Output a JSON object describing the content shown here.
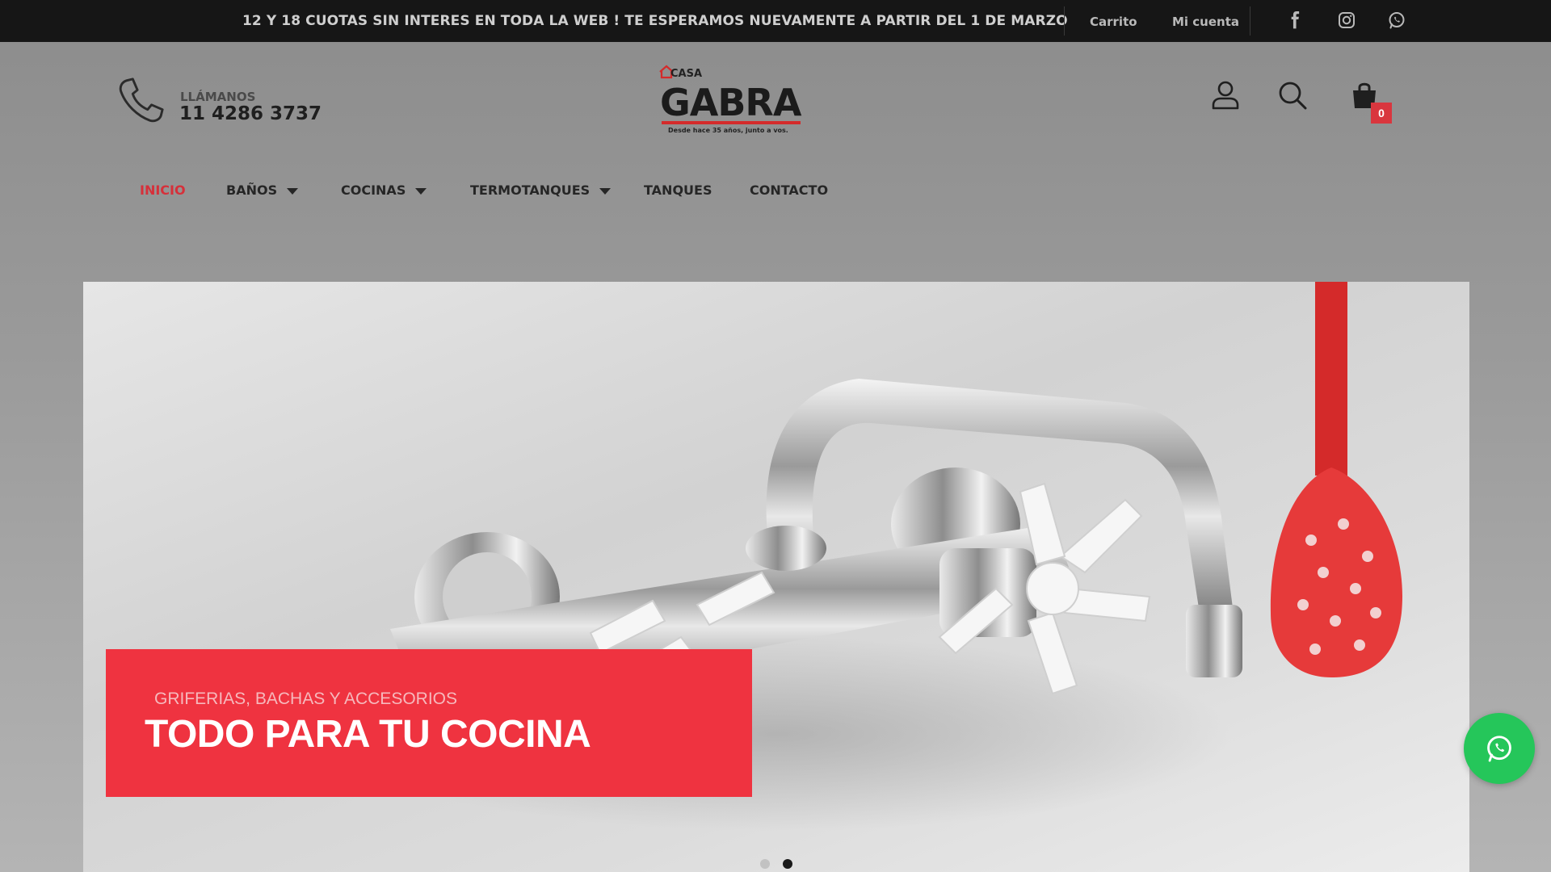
{
  "topbar": {
    "promo": "12 Y 18 CUOTAS SIN INTERES EN TODA LA WEB ! TE ESPERAMOS NUEVAMENTE A PARTIR DEL 1 DE MARZO",
    "links": [
      "Carrito",
      "Mi cuenta"
    ],
    "social_icons": [
      "facebook-icon",
      "instagram-icon",
      "whatsapp-icon"
    ]
  },
  "header": {
    "call_label": "LLÁMANOS",
    "call_number": "11 4286 3737",
    "logo": {
      "small": "CASA",
      "brand": "GABRA",
      "tagline": "Desde hace 35 años, junto a vos."
    },
    "icons": [
      "user-icon",
      "search-icon",
      "cart-icon"
    ],
    "cart_count": "0"
  },
  "nav": {
    "items": [
      {
        "label": "INICIO",
        "active": true,
        "dropdown": false
      },
      {
        "label": "BAÑOS",
        "active": false,
        "dropdown": true
      },
      {
        "label": "COCINAS",
        "active": false,
        "dropdown": true
      },
      {
        "label": "TERMOTANQUES",
        "active": false,
        "dropdown": true
      },
      {
        "label": "TANQUES",
        "active": false,
        "dropdown": false
      },
      {
        "label": "CONTACTO",
        "active": false,
        "dropdown": false
      }
    ]
  },
  "hero": {
    "subtitle": "GRIFERIAS, BACHAS Y ACCESORIOS",
    "headline": "TODO PARA TU COCINA",
    "slides": 2,
    "active_slide": 2
  },
  "colors": {
    "accent": "#ef3340",
    "active_nav": "#d6303a",
    "whatsapp": "#25c65a",
    "topbar": "#161616"
  }
}
